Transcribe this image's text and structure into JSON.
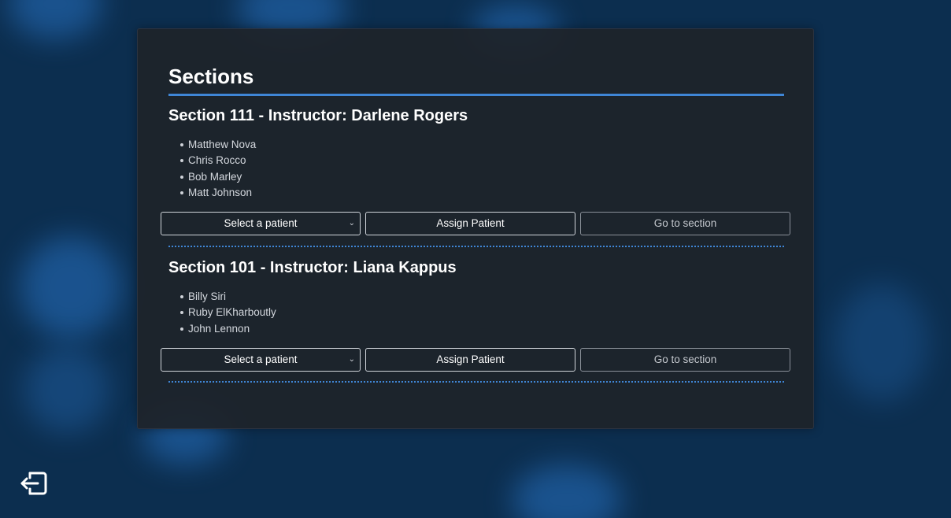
{
  "page": {
    "title": "Sections"
  },
  "sections": [
    {
      "heading": "Section 111 - Instructor: Darlene Rogers",
      "students": [
        "Matthew Nova",
        "Chris Rocco",
        "Bob Marley",
        "Matt Johnson"
      ],
      "select_value": "Select a patient",
      "assign_label": "Assign Patient",
      "goto_label": "Go to section"
    },
    {
      "heading": "Section 101 - Instructor: Liana Kappus",
      "students": [
        "Billy Siri",
        "Ruby ElKharboutly",
        "John Lennon"
      ],
      "select_value": "Select a patient",
      "assign_label": "Assign Patient",
      "goto_label": "Go to section"
    }
  ],
  "icons": {
    "logout": "logout-icon"
  },
  "colors": {
    "accent": "#3f86d6",
    "panel": "#1e232a",
    "background": "#0c2e4f"
  }
}
